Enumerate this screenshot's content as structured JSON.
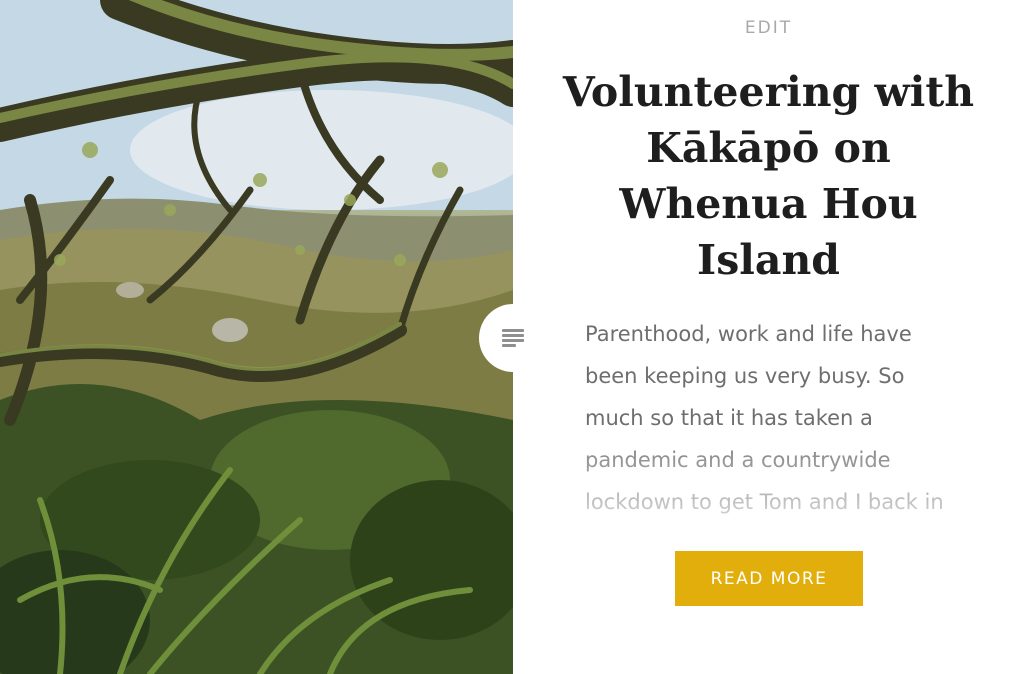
{
  "hero": {
    "image_alt": "Mossy tree branches framing a view over hilly scrubland"
  },
  "post": {
    "edit_label": "EDIT",
    "title": "Volunteering with Kākāpō on Whenua Hou Island",
    "excerpt": "Parenthood, work and life have been keeping us very busy. So much so that it has taken a pandemic and a countrywide lockdown to get Tom and I back in",
    "read_more_label": "READ MORE"
  },
  "colors": {
    "accent": "#e2ae0b",
    "title": "#1e1e1e",
    "body_text": "#6e6e6e",
    "edit_text": "#a9a9a9"
  },
  "icons": {
    "format": "standard-post-format-icon"
  }
}
